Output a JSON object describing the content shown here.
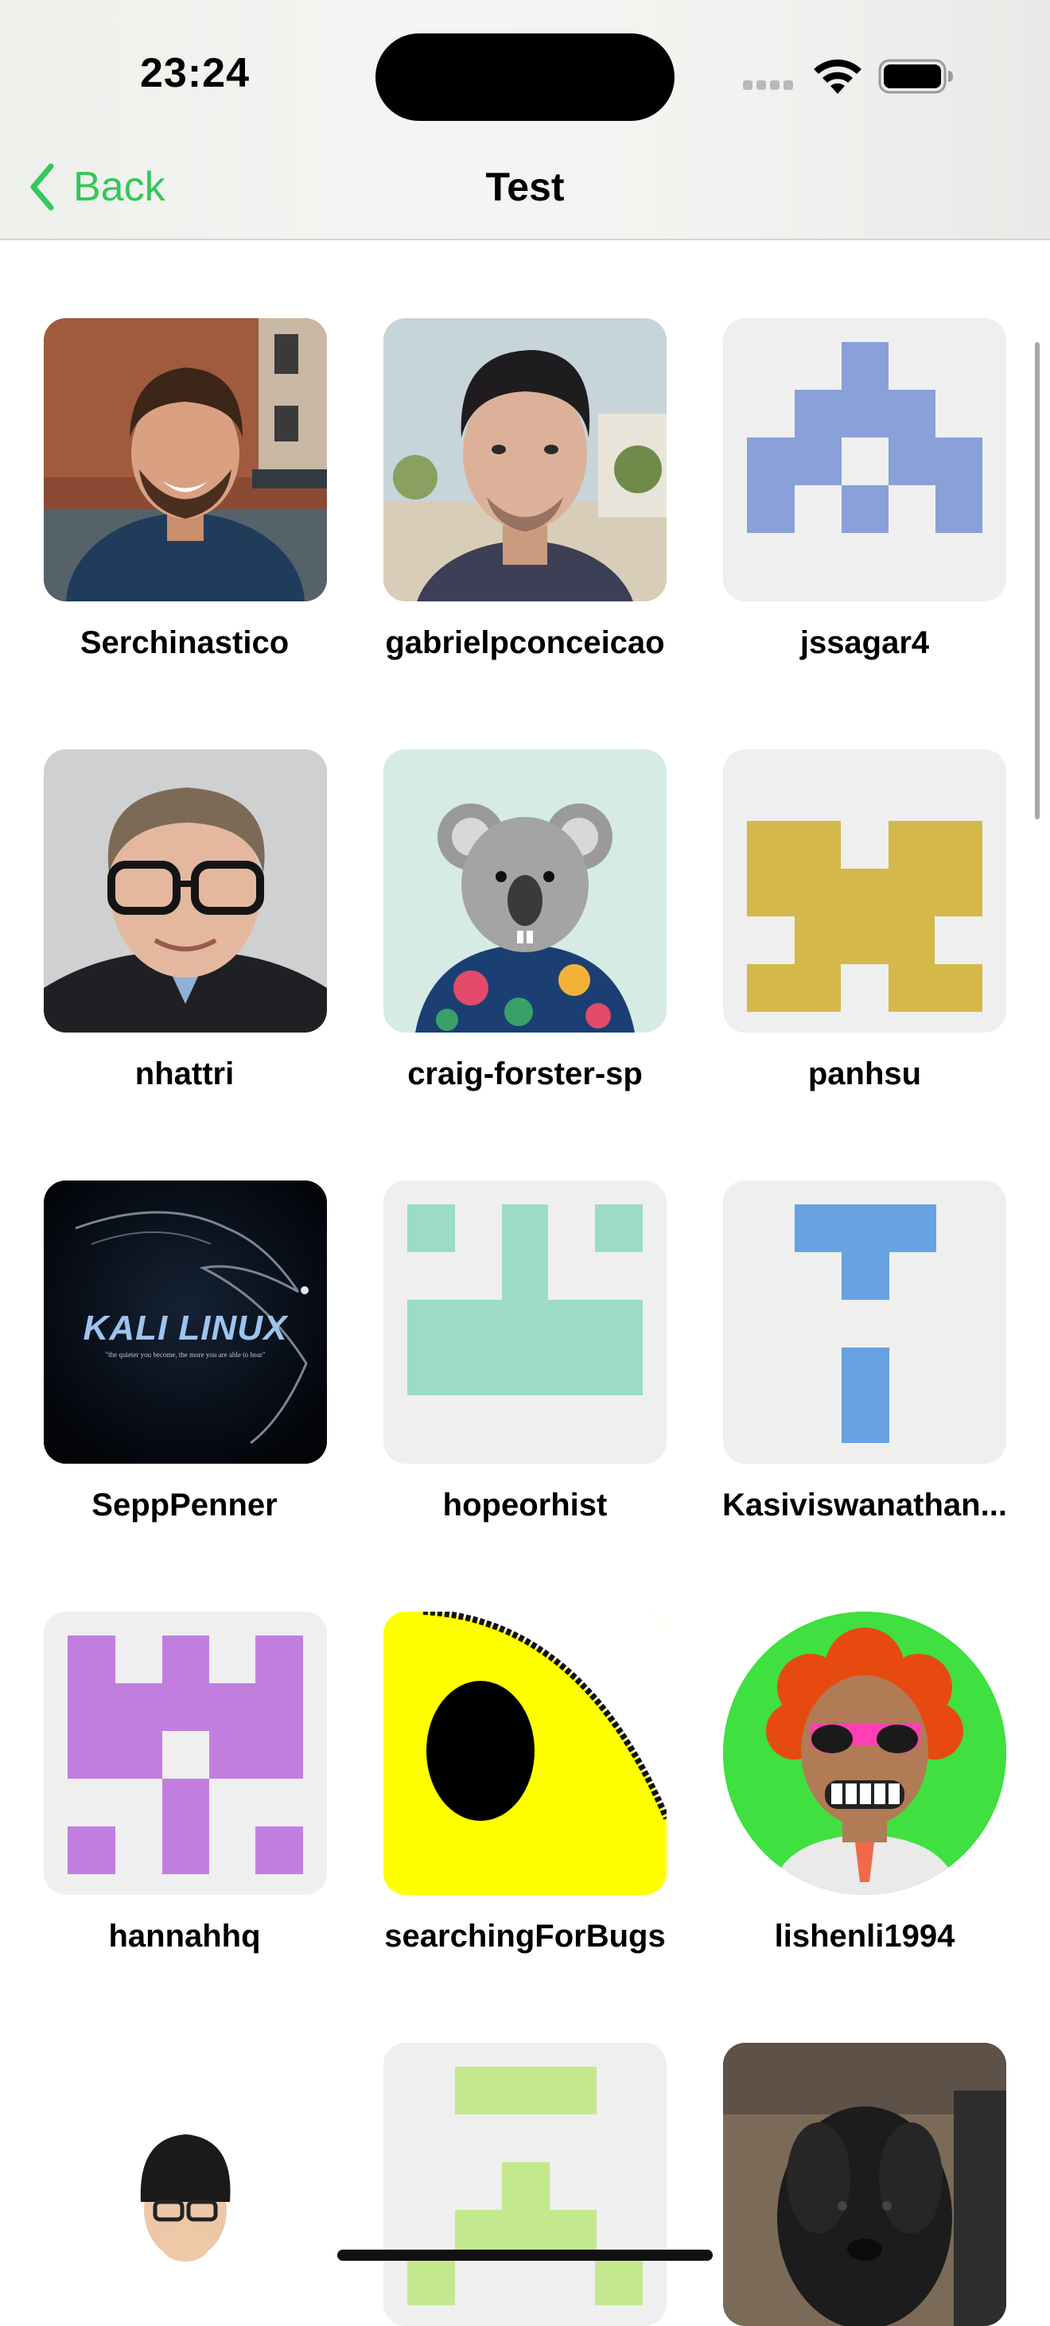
{
  "status_bar": {
    "time": "23:24"
  },
  "nav": {
    "back_label": "Back",
    "title": "Test"
  },
  "colors": {
    "accent": "#34c759",
    "tile_bg": "#efefef"
  },
  "users": [
    {
      "name": "Serchinastico",
      "avatar": "photo-man-beard"
    },
    {
      "name": "gabrielpconceicao",
      "avatar": "photo-man-selfie"
    },
    {
      "name": "jssagar4",
      "avatar": "identicon-blue"
    },
    {
      "name": "nhattri",
      "avatar": "photo-man-glasses"
    },
    {
      "name": "craig-forster-sp",
      "avatar": "koala-illustration"
    },
    {
      "name": "panhsu",
      "avatar": "identicon-gold"
    },
    {
      "name": "SeppPenner",
      "avatar": "kali-linux-logo"
    },
    {
      "name": "hopeorhist",
      "avatar": "identicon-mint"
    },
    {
      "name": "Kasiviswanathan...",
      "avatar": "identicon-lightblue"
    },
    {
      "name": "hannahhq",
      "avatar": "identicon-purple"
    },
    {
      "name": "searchingForBugs",
      "avatar": "yellow-pixel-eye"
    },
    {
      "name": "lishenli1994",
      "avatar": "cartoon-sunglasses"
    },
    {
      "name": "",
      "avatar": "photo-person-hat"
    },
    {
      "name": "",
      "avatar": "identicon-lightgreen"
    },
    {
      "name": "",
      "avatar": "photo-black-dog"
    }
  ],
  "kali_logo": {
    "text": "KALI LINUX",
    "tagline": "\"the quieter you become, the more you are able to hear\""
  }
}
